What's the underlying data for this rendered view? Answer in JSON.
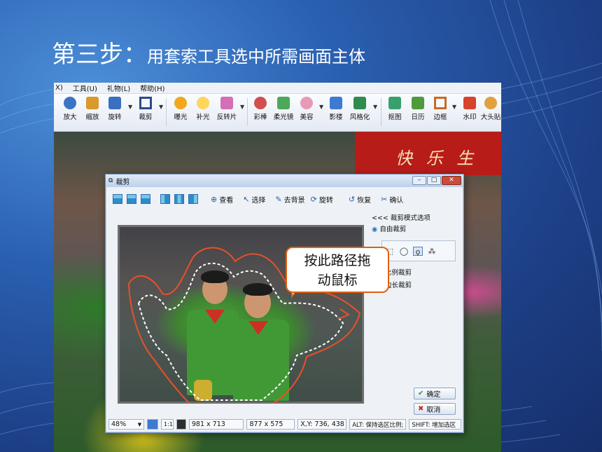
{
  "slide": {
    "title_step": "第三步：",
    "title_text": "用套索工具选中所需画面主体"
  },
  "app": {
    "menu": [
      "X)",
      "工具(U)",
      "礼物(L)",
      "帮助(H)"
    ],
    "toolbar": [
      {
        "label": "放大",
        "icon": "zoom-in-icon",
        "color": "#3a74c4"
      },
      {
        "label": "缩放",
        "icon": "resize-icon",
        "color": "#d89a2a"
      },
      {
        "label": "旋转",
        "icon": "rotate-icon",
        "color": "#3b6fc0"
      },
      {
        "label": "裁剪",
        "icon": "crop-icon",
        "color": "#2b4c8a"
      },
      {
        "label": "曝光",
        "icon": "exposure-icon",
        "color": "#f2a71d"
      },
      {
        "label": "补光",
        "icon": "fill-light-icon",
        "color": "#ffd65c"
      },
      {
        "label": "反转片",
        "icon": "reversal-film-icon",
        "color": "#d26fb6"
      },
      {
        "label": "彩棒",
        "icon": "color-wand-icon",
        "color": "#d24e4e"
      },
      {
        "label": "柔光镜",
        "icon": "soft-light-icon",
        "color": "#4ea85c"
      },
      {
        "label": "美容",
        "icon": "beauty-icon",
        "color": "#e79ab4"
      },
      {
        "label": "影楼",
        "icon": "studio-icon",
        "color": "#3e7ad0"
      },
      {
        "label": "风格化",
        "icon": "stylize-icon",
        "color": "#2f8c4e"
      },
      {
        "label": "抠图",
        "icon": "cutout-icon",
        "color": "#39a06d"
      },
      {
        "label": "日历",
        "icon": "calendar-icon",
        "color": "#4f9a3c"
      },
      {
        "label": "边框",
        "icon": "frame-icon",
        "color": "#c96a23"
      },
      {
        "label": "水印",
        "icon": "watermark-icon",
        "color": "#d6442e"
      },
      {
        "label": "大头贴",
        "icon": "sticker-icon",
        "color": "#e0a23c"
      }
    ]
  },
  "dialog": {
    "title": "裁剪",
    "toolbar": {
      "view": "查看",
      "select": "选择",
      "remove_bg": "去背景",
      "rotate": "旋转",
      "restore": "恢复",
      "confirm": "确认"
    },
    "panel": {
      "header": "<<< 裁剪模式选项",
      "free_crop": "自由裁剪",
      "ratio_crop": "宽高比例裁剪",
      "fixed_crop": "固定边长裁剪",
      "ok": "确定",
      "cancel": "取消"
    },
    "status": {
      "zoom": "48%",
      "fit": "1:1",
      "image_size": "981 x 713",
      "selection_size": "877 x 575",
      "coords": "X,Y: 736, 438",
      "alt_hint": "ALT: 保持选区比例;",
      "shift_hint": "SHIFT: 增加选区"
    }
  },
  "background_banner": "快 乐 生 活",
  "callout": {
    "line1": "按此路径拖",
    "line2": "动鼠标"
  }
}
